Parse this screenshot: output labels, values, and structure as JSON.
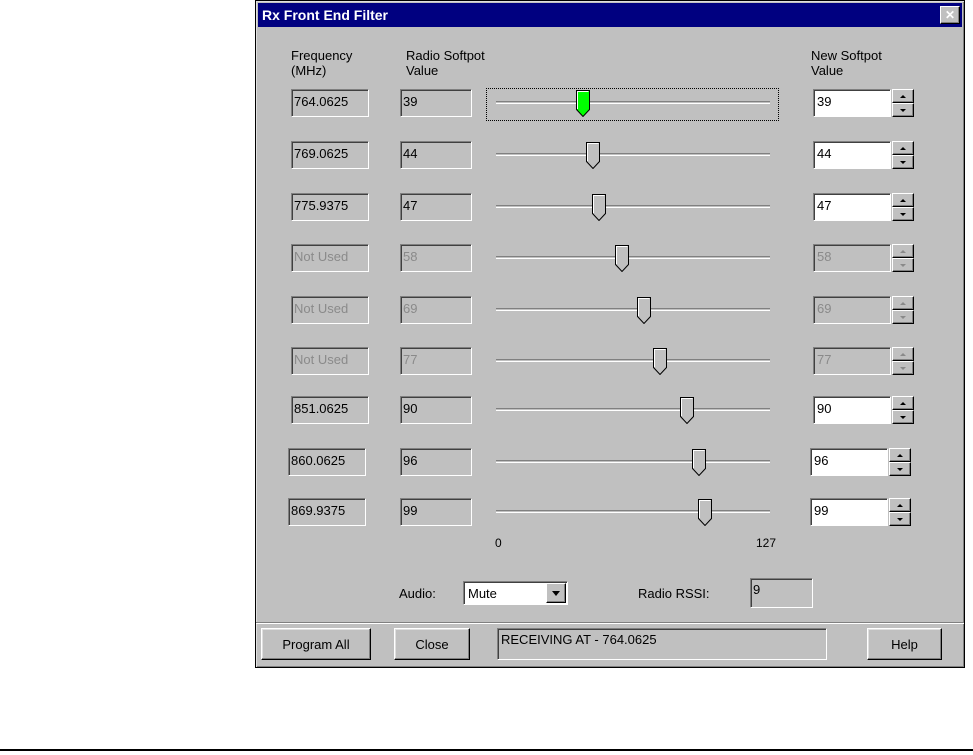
{
  "window": {
    "title": "Rx Front End Filter",
    "close_glyph": "✕"
  },
  "headers": {
    "frequency_line1": "Frequency",
    "frequency_line2": "(MHz)",
    "radio_line1": "Radio Softpot",
    "radio_line2": "Value",
    "new_line1": "New Softpot",
    "new_line2": "Value"
  },
  "rows": [
    {
      "frequency": "764.0625",
      "radio_value": "39",
      "slider_value": 39,
      "new_value": "39",
      "enabled": true,
      "focused": true
    },
    {
      "frequency": "769.0625",
      "radio_value": "44",
      "slider_value": 44,
      "new_value": "44",
      "enabled": true,
      "focused": false
    },
    {
      "frequency": "775.9375",
      "radio_value": "47",
      "slider_value": 47,
      "new_value": "47",
      "enabled": true,
      "focused": false
    },
    {
      "frequency": "Not Used",
      "radio_value": "58",
      "slider_value": 58,
      "new_value": "58",
      "enabled": false,
      "focused": false
    },
    {
      "frequency": "Not Used",
      "radio_value": "69",
      "slider_value": 69,
      "new_value": "69",
      "enabled": false,
      "focused": false
    },
    {
      "frequency": "Not Used",
      "radio_value": "77",
      "slider_value": 77,
      "new_value": "77",
      "enabled": false,
      "focused": false
    },
    {
      "frequency": "851.0625",
      "radio_value": "90",
      "slider_value": 90,
      "new_value": "90",
      "enabled": true,
      "focused": false
    },
    {
      "frequency": "860.0625",
      "radio_value": "96",
      "slider_value": 96,
      "new_value": "96",
      "enabled": true,
      "focused": false
    },
    {
      "frequency": "869.9375",
      "radio_value": "99",
      "slider_value": 99,
      "new_value": "99",
      "enabled": true,
      "focused": false
    }
  ],
  "slider_scale": {
    "min": 0,
    "max": 127,
    "min_label": "0",
    "max_label": "127"
  },
  "colors": {
    "active_thumb": "#00ff00",
    "thumb": "#c0c0c0"
  },
  "audio": {
    "label": "Audio:",
    "selected": "Mute"
  },
  "rssi": {
    "label": "Radio RSSI:",
    "value": "9"
  },
  "buttons": {
    "program_all": "Program All",
    "close": "Close",
    "help": "Help"
  },
  "status": "RECEIVING AT - 764.0625"
}
